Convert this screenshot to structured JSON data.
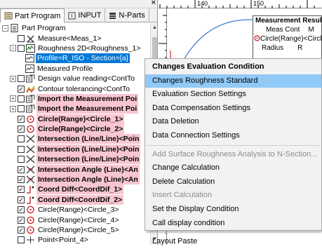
{
  "tabs": [
    {
      "label": "Part Program",
      "icon": "program-icon"
    },
    {
      "label": "INPUT",
      "icon": "input-icon"
    },
    {
      "label": "N-Parts",
      "icon": "nparts-icon"
    }
  ],
  "tree": [
    {
      "indent": 0,
      "exp": "−",
      "cb": null,
      "icon": "document-icon",
      "label": "Part Program"
    },
    {
      "indent": 1,
      "exp": null,
      "cb": "",
      "icon": "measure-icon",
      "label": "Measure<Meas_1>"
    },
    {
      "indent": 1,
      "exp": "−",
      "cb": "",
      "icon": "roughness-icon",
      "label": "Roughness 2D<Roughness_1>"
    },
    {
      "indent": 2,
      "exp": null,
      "cb": null,
      "icon": "profile-icon",
      "label": "Profile=R_ISO - Section=[a]",
      "selected": true
    },
    {
      "indent": 2,
      "exp": null,
      "cb": null,
      "icon": "profile-icon",
      "label": "Measured Profile"
    },
    {
      "indent": 1,
      "exp": "+",
      "cb": "",
      "icon": "import-icon",
      "label": "Design value reading<ContTo"
    },
    {
      "indent": 1,
      "exp": null,
      "cb": "✓",
      "icon": "contour-icon",
      "label": "Contour tolerancing<ContTo"
    },
    {
      "indent": 1,
      "exp": "+",
      "cb": "",
      "icon": "import-icon",
      "label": "Import the Measurement Poi",
      "pink": true
    },
    {
      "indent": 1,
      "exp": "+",
      "cb": "",
      "icon": "import-icon",
      "label": "Import the Measurement Poi",
      "pink": true
    },
    {
      "indent": 1,
      "exp": null,
      "cb": "✓",
      "icon": "circle-icon",
      "label": "Circle(Range)<Circle_1>",
      "pink": true
    },
    {
      "indent": 1,
      "exp": null,
      "cb": "✓",
      "icon": "circle-icon",
      "label": "Circle(Range)<Circle_2>",
      "pink": true
    },
    {
      "indent": 1,
      "exp": null,
      "cb": "",
      "icon": "intersection-icon",
      "label": "Intersection (Line/Line)<Poin",
      "pink": true
    },
    {
      "indent": 1,
      "exp": null,
      "cb": "",
      "icon": "intersection-icon",
      "label": "Intersection (Line/Line)<Poin",
      "pink": true
    },
    {
      "indent": 1,
      "exp": null,
      "cb": "",
      "icon": "intersection-icon",
      "label": "Intersection (Line/Line)<Poin",
      "pink": true
    },
    {
      "indent": 1,
      "exp": null,
      "cb": "✓",
      "icon": "angle-icon",
      "label": "Intersection Angle (Line)<An",
      "pink": true
    },
    {
      "indent": 1,
      "exp": null,
      "cb": "✓",
      "icon": "angle-icon",
      "label": "Intersection Angle (Line)<An",
      "pink": true
    },
    {
      "indent": 1,
      "exp": null,
      "cb": "✓",
      "icon": "coord-icon",
      "label": "Coord Diff<CoordDif_1>",
      "pink": true
    },
    {
      "indent": 1,
      "exp": null,
      "cb": "✓",
      "icon": "coord-icon",
      "label": "Coord Diff<CoordDif_2>",
      "pink": true
    },
    {
      "indent": 1,
      "exp": null,
      "cb": "✓",
      "icon": "circle-icon",
      "label": "Circle(Range)<Circle_3>"
    },
    {
      "indent": 1,
      "exp": null,
      "cb": "✓",
      "icon": "circle-icon",
      "label": "Circle(Range)<Circle_4>"
    },
    {
      "indent": 1,
      "exp": null,
      "cb": "✓",
      "icon": "circle-icon",
      "label": "Circle(Range)<Circle_5>"
    },
    {
      "indent": 1,
      "exp": null,
      "cb": "",
      "icon": "point-icon",
      "label": "Point<Point_4>"
    }
  ],
  "ruler": {
    "t1": "140",
    "t2": "150"
  },
  "results": {
    "title": "Measurement Results",
    "row1a": "Meas Cont",
    "row1b": "M",
    "row2": "Circle(Range)<Circle",
    "row3a": "Radius",
    "row3b": "R"
  },
  "menu": [
    {
      "label": "Changes Evaluation Condition",
      "bold": true
    },
    {
      "label": "Changes Roughness Standard",
      "highlight": true
    },
    {
      "label": "Evaluation Section Settings"
    },
    {
      "label": "Data Compensation Settings"
    },
    {
      "label": "Data Deletion"
    },
    {
      "label": "Data Connection Settings"
    },
    {
      "sep": true
    },
    {
      "label": "Add Surface Roughness Analysis to N-Section...",
      "disabled": true
    },
    {
      "label": "Change Calculation"
    },
    {
      "label": "Delete Calculation"
    },
    {
      "label": "Insert Calculation",
      "disabled": true
    },
    {
      "label": "Set the Display Condition"
    },
    {
      "label": "Call display condition"
    },
    {
      "sep": true
    },
    {
      "label": "Layout Paste"
    }
  ],
  "colors": {
    "selection": "#0078d7",
    "pink": "#f7c6d0",
    "menu_highlight": "#91c9f7",
    "circle_red": "#d11a1a"
  }
}
